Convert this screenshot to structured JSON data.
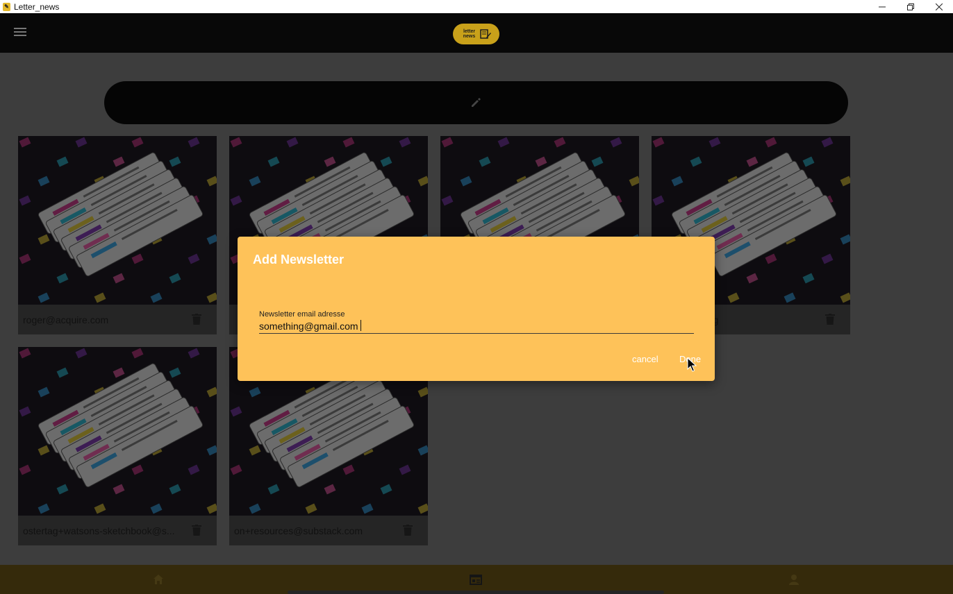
{
  "window": {
    "title": "Letter_news"
  },
  "appbar": {
    "logo_text": "letter news"
  },
  "cards": [
    {
      "email": "roger@acquire.com"
    },
    {
      "email": ""
    },
    {
      "email": ""
    },
    {
      "email": "kysthelimit.org"
    },
    {
      "email": "ostertag+watsons-sketchbook@s..."
    },
    {
      "email": "on+resources@substack.com"
    }
  ],
  "dialog": {
    "title": "Add Newsletter",
    "field_label": "Newsletter email adresse",
    "field_value": "something@gmail.com",
    "cancel_label": "cancel",
    "done_label": "Done"
  },
  "colors": {
    "dialog_bg": "#fec259",
    "appbar_bg": "#080808",
    "logo_bg": "#c9a11a",
    "bottomnav_bg": "#6b5516"
  },
  "icons": [
    "menu-icon",
    "edit-icon",
    "trash-icon",
    "home-icon",
    "newsletter-icon",
    "profile-icon"
  ]
}
